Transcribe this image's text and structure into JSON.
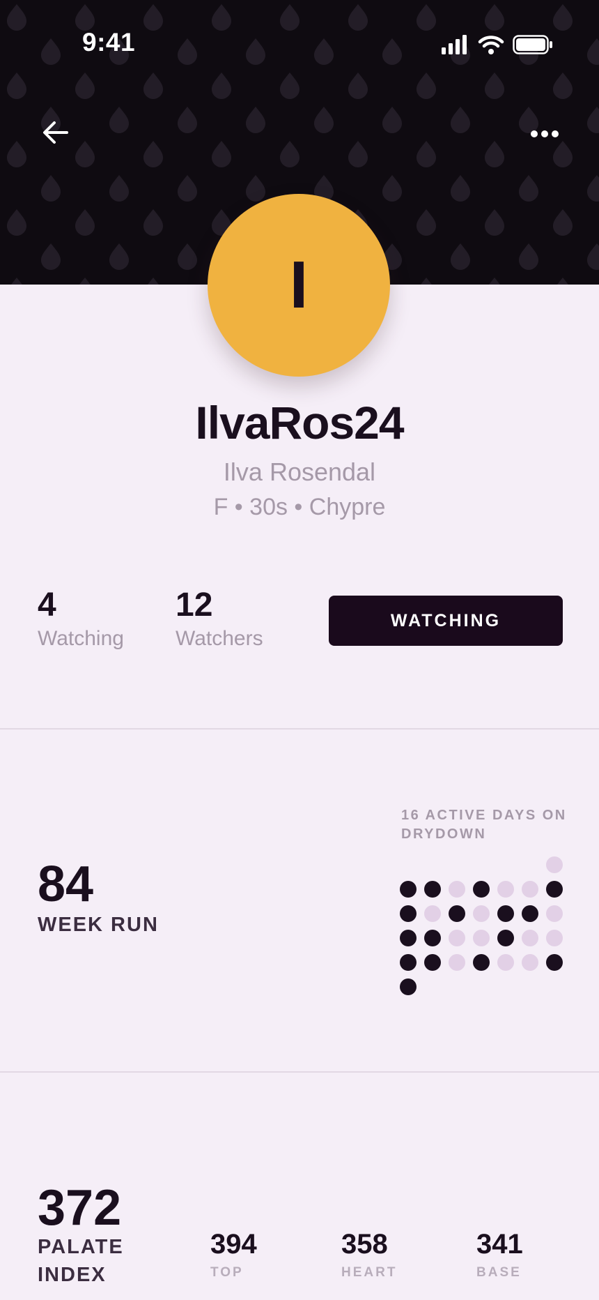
{
  "status_bar": {
    "time": "9:41"
  },
  "header": {
    "colors": {
      "background": "#0f0b11",
      "pattern": "#231d27"
    },
    "icons": {
      "back": "arrow-left-icon",
      "more": "more-horizontal-icon"
    }
  },
  "profile": {
    "initial": "I",
    "avatar_color": "#f0b240",
    "username": "IlvaRos24",
    "full_name": "Ilva Rosendal",
    "meta": "F • 30s • Chypre"
  },
  "stats": {
    "watching": {
      "value": "4",
      "label": "Watching"
    },
    "watchers": {
      "value": "12",
      "label": "Watchers"
    },
    "button_label": "WATCHING"
  },
  "week_run": {
    "value": "84",
    "label": "WEEK RUN",
    "active_days_label": "16 ACTIVE DAYS ON DRYDOWN",
    "dot_rows": [
      [
        0,
        0,
        0,
        0,
        0,
        0,
        1
      ],
      [
        2,
        2,
        1,
        2,
        1,
        1,
        2
      ],
      [
        2,
        1,
        2,
        1,
        2,
        2,
        1
      ],
      [
        2,
        2,
        1,
        1,
        2,
        1,
        1
      ],
      [
        2,
        2,
        1,
        2,
        1,
        1,
        2
      ],
      [
        2,
        0,
        0,
        0,
        0,
        0,
        0
      ]
    ],
    "colors": {
      "active": "#1a0f1e",
      "inactive": "#e2d0e6"
    }
  },
  "palate": {
    "value": "372",
    "label": "PALATE INDEX",
    "notes": [
      {
        "value": "394",
        "label": "TOP"
      },
      {
        "value": "358",
        "label": "HEART"
      },
      {
        "value": "341",
        "label": "BASE"
      }
    ]
  }
}
